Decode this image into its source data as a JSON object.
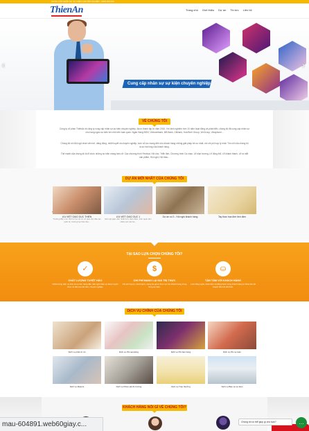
{
  "topbar": {
    "tagline": "CUNG CẤP NHÂN SỰ SỰ KIỆN CHUYÊN NGHIỆP - 0908 000 000"
  },
  "header": {
    "logo_text": "ThienAn",
    "nav": [
      "Trang chủ",
      "Giới thiệu",
      "Dự án",
      "Tin tức",
      "Liên hệ"
    ]
  },
  "hero": {
    "slogan": "Cung cấp nhân sự sự kiện chuyên nghiệp",
    "prev_label": "‹",
    "next_label": "›"
  },
  "about": {
    "title": "VỀ CHÚNG TÔI",
    "paragraphs": [
      "Công ty cổ phần ThiênAn là công ty cung cấp nhân sự sự kiện chuyên nghiệp, được thành lập từ năm 2010. Với kinh nghiệm hơn 10 năm hoạt động và phát triển, chúng tôi đã cung cấp nhân sự cho hàng ngàn sự kiện lớn nhỏ trên toàn quốc: Ngân Hàng BIDV, Vietcombank, MB Bank, Citibank, Hoà Bình Group, VinGroup, Vinaphone...",
      "Chúng tôi với đội ngũ nhân viên trẻ, năng động, nhiệt huyết và chuyên nghiệp, luôn nỗ lực mang đến cho khách hàng những giải pháp tối ưu nhất, với chi phí hợp lý nhất. Tôn chỉ của chúng tôi là sự hài lòng của khách hàng.",
      "Thế mạnh của chúng tôi là tổ chức những sự kiện mang tầm cỡ: Các chương trình Festival, Hội chợ, Triển lãm, Chương trình Ca nhạc, Lễ khai trương, Lễ động thổ, Lễ khánh thành, Lễ ra mắt sản phẩm, Hội nghị, Hội thảo..."
    ]
  },
  "projects": {
    "title": "DỰ ÁN MỚI NHẤT CỦA CHÚNG TÔI",
    "items": [
      {
        "caption": "ƯU VIỆT GIÁO DỤC THIÊN",
        "desc": "Trường Mầm non Việt Úc là một cơ sở giáo dục đào tạo quốc tế, trường học hiện đại..."
      },
      {
        "caption": "ƯU VIỆT GIÁO DỤC 1",
        "desc": "Đội ngũ giáo viên nhiệt tình, thân thiện, luôn quan tâm chăm sóc các bé..."
      },
      {
        "caption": "Dự án số 3 - Hội nghị khách hàng",
        "desc": ""
      },
      {
        "caption": "Tay thao hoa đơn tien dien",
        "desc": ""
      }
    ]
  },
  "why": {
    "title": "TẠI SAO LỰA CHỌN CHÚNG TÔI?",
    "features": [
      {
        "icon": "check-icon",
        "glyph": "✓",
        "title": "CHẤT LƯỢNG TUYỆT HẢO",
        "desc": "Chất lượng dịch vụ luôn là ưu tiên hàng đầu. Đội ngũ nhân sự được tuyển chọn và đào tạo bài bản, chuyên nghiệp."
      },
      {
        "icon": "tag-icon",
        "glyph": "$",
        "title": "CHI PHÍ MANG LẠI GIÁ TRỊ THỰC",
        "desc": "Chi phí hợp lý, minh bạch, mang lại giá trị thực sự cho khách hàng trong từng sự kiện."
      },
      {
        "icon": "handshake-icon",
        "glyph": "⛀",
        "title": "TẬN TÂM VỚI KHÁCH HÀNG",
        "desc": "Luôn lắng nghe, thấu hiểu và đồng hành cùng khách hàng từ khâu lên kế hoạch đến khi kết thúc."
      }
    ]
  },
  "services": {
    "title": "DỊCH VỤ CHÍNH CỦA CHÚNG TÔI",
    "items": [
      {
        "caption": "Dịch vụ phát tờ rơi"
      },
      {
        "caption": "Dịch vụ PG sampling"
      },
      {
        "caption": "Dịch vụ PG bán hàng"
      },
      {
        "caption": "Dịch vụ PG sự kiện"
      },
      {
        "caption": "Dịch vụ Mascot"
      },
      {
        "caption": "Dịch vụ Khảo sát thị trường"
      },
      {
        "caption": "Dịch vụ Trao thưởng"
      },
      {
        "caption": "Dịch vụ Bảo vệ sự kiện"
      }
    ]
  },
  "customers": {
    "title": "KHÁCH HÀNG NÓI GÌ VỀ CHÚNG TÔI?"
  },
  "overlay": {
    "url": "mau-604891.web60giay.c...",
    "chat_prompt": "Chúng tôi có thể giúp gì cho bạn?"
  },
  "colors": {
    "accent": "#f6b800",
    "orange": "#f28c0f",
    "brand_blue": "#1c56b0",
    "title_red": "#c8101a"
  }
}
